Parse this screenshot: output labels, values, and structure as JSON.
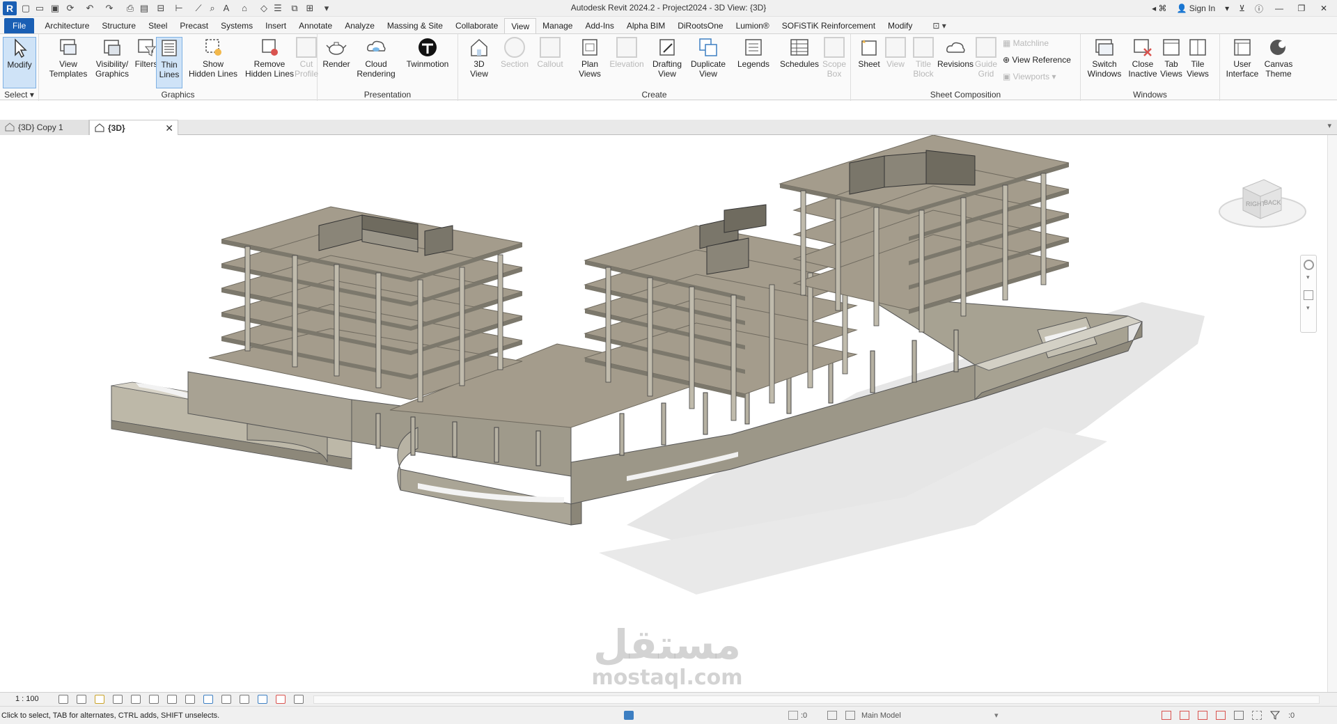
{
  "app": {
    "logo": "R",
    "window_title": "Autodesk Revit 2024.2 - Project2024 - 3D View: {3D}",
    "sign_in": "Sign In",
    "help": "?"
  },
  "ribbon_tabs": [
    "File",
    "Architecture",
    "Structure",
    "Steel",
    "Precast",
    "Systems",
    "Insert",
    "Annotate",
    "Analyze",
    "Massing & Site",
    "Collaborate",
    "View",
    "Manage",
    "Add-Ins",
    "Alpha BIM",
    "DiRootsOne",
    "Lumion®",
    "SOFiSTiK Reinforcement",
    "Modify"
  ],
  "active_tab": "View",
  "ribbon": {
    "select": {
      "modify": "Modify",
      "label": "Select"
    },
    "graphics": {
      "label": "Graphics",
      "view_templates": "View\nTemplates",
      "visibility_graphics": "Visibility/\nGraphics",
      "filters": "Filters",
      "thin_lines": "Thin\nLines",
      "show_hidden_lines": "Show\nHidden Lines",
      "remove_hidden_lines": "Remove\nHidden Lines",
      "cut_profile": "Cut\nProfile"
    },
    "presentation": {
      "label": "Presentation",
      "render": "Render",
      "cloud_rendering": "Cloud\nRendering",
      "twinmotion": "Twinmotion"
    },
    "create": {
      "label": "Create",
      "view_3d": "3D\nView",
      "section": "Section",
      "callout": "Callout",
      "plan_views": "Plan\nViews",
      "elevation": "Elevation",
      "drafting_view": "Drafting\nView",
      "duplicate_view": "Duplicate\nView",
      "legends": "Legends",
      "schedules": "Schedules",
      "scope_box": "Scope\nBox"
    },
    "sheet_composition": {
      "label": "Sheet Composition",
      "sheet": "Sheet",
      "view": "View",
      "title_block": "Title\nBlock",
      "revisions": "Revisions",
      "guide_grid": "Guide\nGrid",
      "matchline": "Matchline",
      "view_reference": "View  Reference",
      "viewports": "Viewports"
    },
    "windows": {
      "label": "Windows",
      "switch_windows": "Switch\nWindows",
      "close_inactive": "Close\nInactive",
      "tab_views": "Tab\nViews",
      "tile_views": "Tile\nViews"
    },
    "user_interface": {
      "user_interface": "User\nInterface",
      "canvas_theme": "Canvas\nTheme"
    }
  },
  "view_tabs": [
    {
      "label": "{3D} Copy 1"
    },
    {
      "label": "{3D}",
      "close": "✕"
    }
  ],
  "viewcube": {
    "faces": [
      "RIGHT",
      "BACK"
    ]
  },
  "watermark": {
    "arabic": "مستقل",
    "latin": "mostaql.com"
  },
  "view_control": {
    "scale": "1 : 100"
  },
  "status_bar": {
    "message": "Click to select, TAB for alternates, CTRL adds, SHIFT unselects.",
    "worksets_count": ":0",
    "model": "Main Model",
    "filter_count": ":0"
  },
  "colors": {
    "accent": "#1a5fb4",
    "slab": "#a49c8c",
    "slab_edge": "#6f6a5f",
    "shadow": "#e4e4e4"
  }
}
